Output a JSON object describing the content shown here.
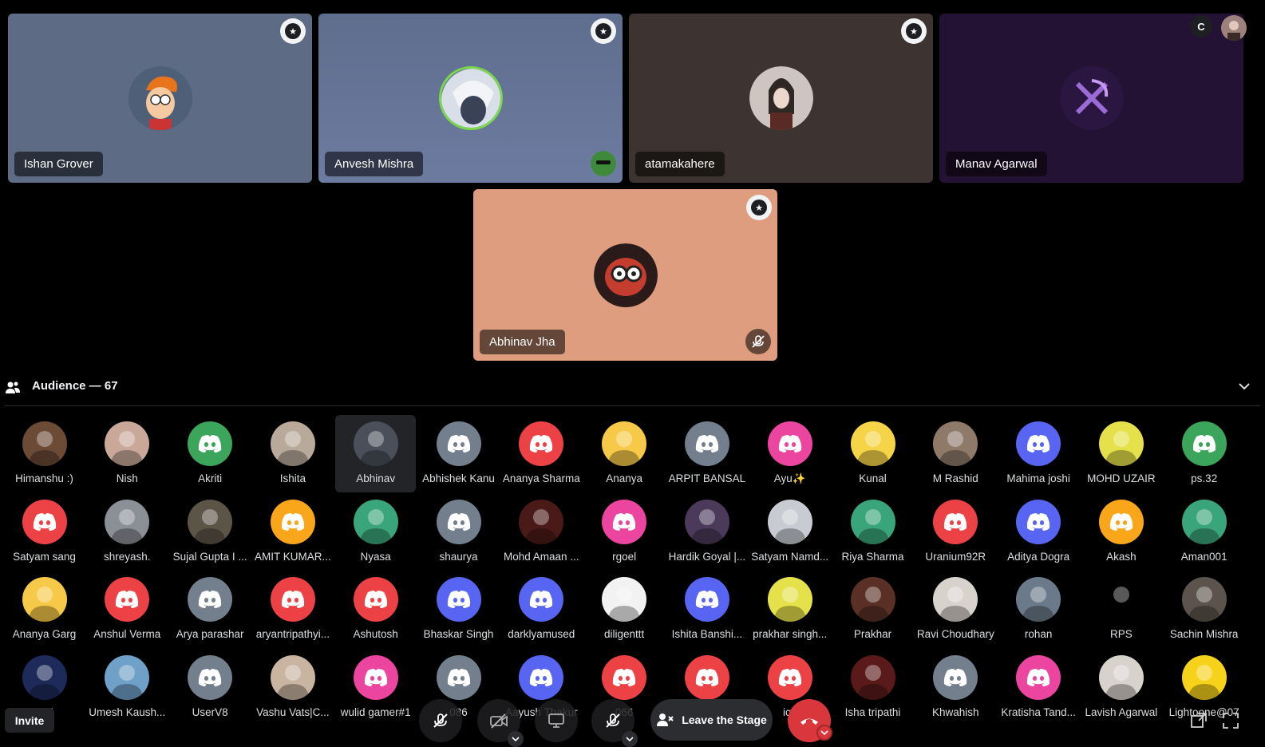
{
  "stage": {
    "tiles": [
      {
        "name": "Ishan Grover"
      },
      {
        "name": "Anvesh Mishra"
      },
      {
        "name": "atamakahere"
      },
      {
        "name": "Manav Agarwal"
      },
      {
        "name": "Abhinav Jha"
      }
    ],
    "corner_badge": "C"
  },
  "audience": {
    "title": "Audience — 67",
    "members": [
      "Himanshu :)",
      "Nish",
      "Akriti",
      "Ishita",
      "Abhinav",
      "Abhishek Kanu",
      "Ananya Sharma",
      "Ananya",
      "ARPIT BANSAL",
      "Ayu✨",
      "Kunal",
      "M Rashid",
      "Mahima joshi",
      "MOHD UZAIR",
      "ps.32",
      "Satyam sang",
      "shreyash.",
      "Sujal Gupta I ...",
      "AMIT KUMAR...",
      "Nyasa",
      "shaurya",
      "Mohd Amaan ...",
      "rgoel",
      "Hardik Goyal |...",
      "Satyam Namd...",
      "Riya Sharma",
      "Uranium92R",
      "Aditya Dogra",
      "Akash",
      "Aman001",
      "Ananya Garg",
      "Anshul Verma",
      "Arya parashar",
      "aryantripathyi...",
      "Ashutosh",
      "Bhaskar Singh",
      "darklyamused",
      "diligenttt",
      "Ishita Banshi...",
      "prakhar singh...",
      "Prakhar",
      "Ravi Choudhary",
      "rohan",
      "RPS",
      "Sachin Mishra",
      "_07",
      "Umesh Kaush...",
      "UserV8",
      "Vashu Vats|C...",
      "wulid gamer#1",
      "086",
      "Aayush Thakur",
      "066",
      "",
      "ica",
      "Isha tripathi",
      "Khwahish",
      "Kratisha Tand...",
      "Lavish Agarwal",
      "Lightoone@07"
    ]
  },
  "controls": {
    "invite": "Invite",
    "leave_stage": "Leave the Stage"
  },
  "colors": {
    "discord_red": "#ed4245",
    "discord_blurple": "#5865f2",
    "discord_green": "#3ba55c",
    "discord_grey": "#747f8d",
    "discord_pink": "#eb459f",
    "discord_orange": "#faa61a"
  }
}
